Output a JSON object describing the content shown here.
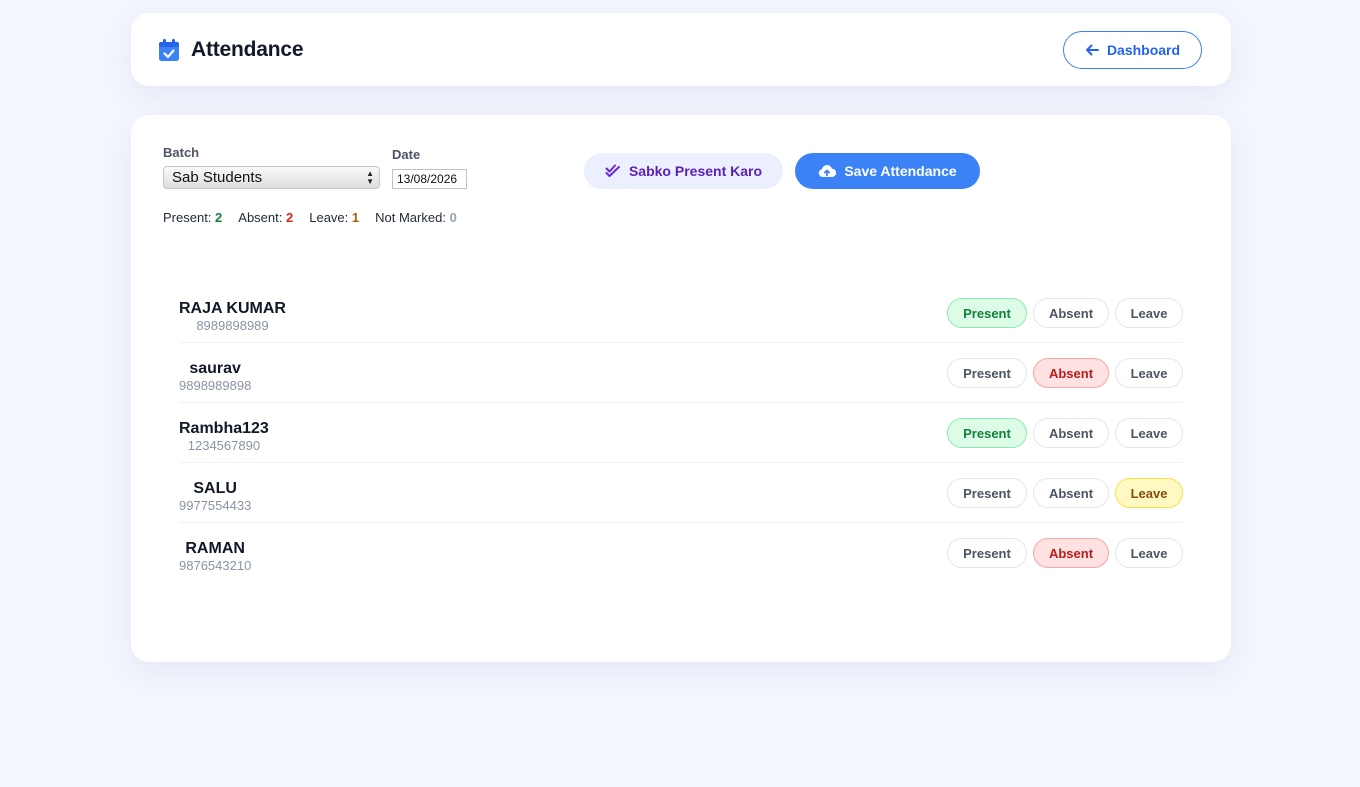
{
  "header": {
    "title": "Attendance",
    "dashboard_label": "Dashboard"
  },
  "filters": {
    "batch_label": "Batch",
    "batch_value": "Sab Students",
    "date_label": "Date",
    "date_value": "13/08/2026"
  },
  "actions": {
    "present_all_label": "Sabko Present Karo",
    "save_label": "Save Attendance"
  },
  "summary": {
    "present_label": "Present:",
    "present_count": "2",
    "absent_label": "Absent:",
    "absent_count": "2",
    "leave_label": "Leave:",
    "leave_count": "1",
    "unmarked_label": "Not Marked:",
    "unmarked_count": "0"
  },
  "status_labels": {
    "present": "Present",
    "absent": "Absent",
    "leave": "Leave"
  },
  "students": [
    {
      "name": "RAJA KUMAR",
      "phone": "8989898989",
      "status": "present"
    },
    {
      "name": "saurav",
      "phone": "9898989898",
      "status": "absent"
    },
    {
      "name": "Rambha123",
      "phone": "1234567890",
      "status": "present"
    },
    {
      "name": "SALU",
      "phone": "9977554433",
      "status": "leave"
    },
    {
      "name": "RAMAN",
      "phone": "9876543210",
      "status": "absent"
    }
  ],
  "colors": {
    "accent": "#3b82f6",
    "present": "#15803d",
    "absent": "#dc2626",
    "leave": "#a16207"
  }
}
